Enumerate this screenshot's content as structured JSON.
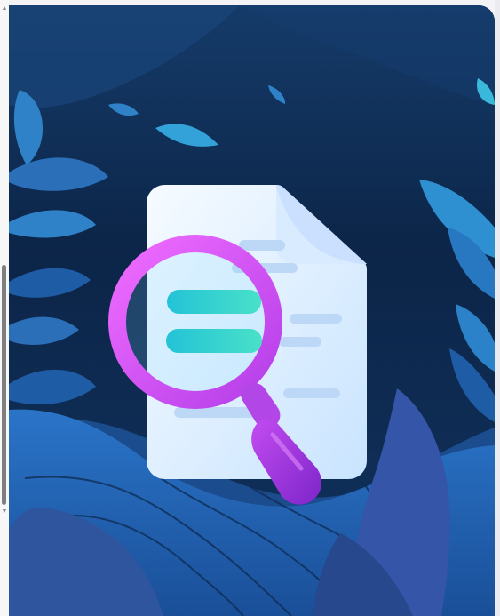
{
  "illustration": {
    "subject": "search-document-icon",
    "colors": {
      "background_dark": "#0c2548",
      "background_mid": "#163f73",
      "leaf_light": "#2a8fd1",
      "leaf_dark": "#123a74",
      "hill_front": "#1f62b8",
      "document": "#e7f2ff",
      "magnifier_ring": "#d857f2",
      "magnifier_handle": "#9b35db",
      "teal_bar": "#2ed3c5"
    }
  },
  "scrollbar": {
    "thumb_color": "#7f7f7f"
  }
}
